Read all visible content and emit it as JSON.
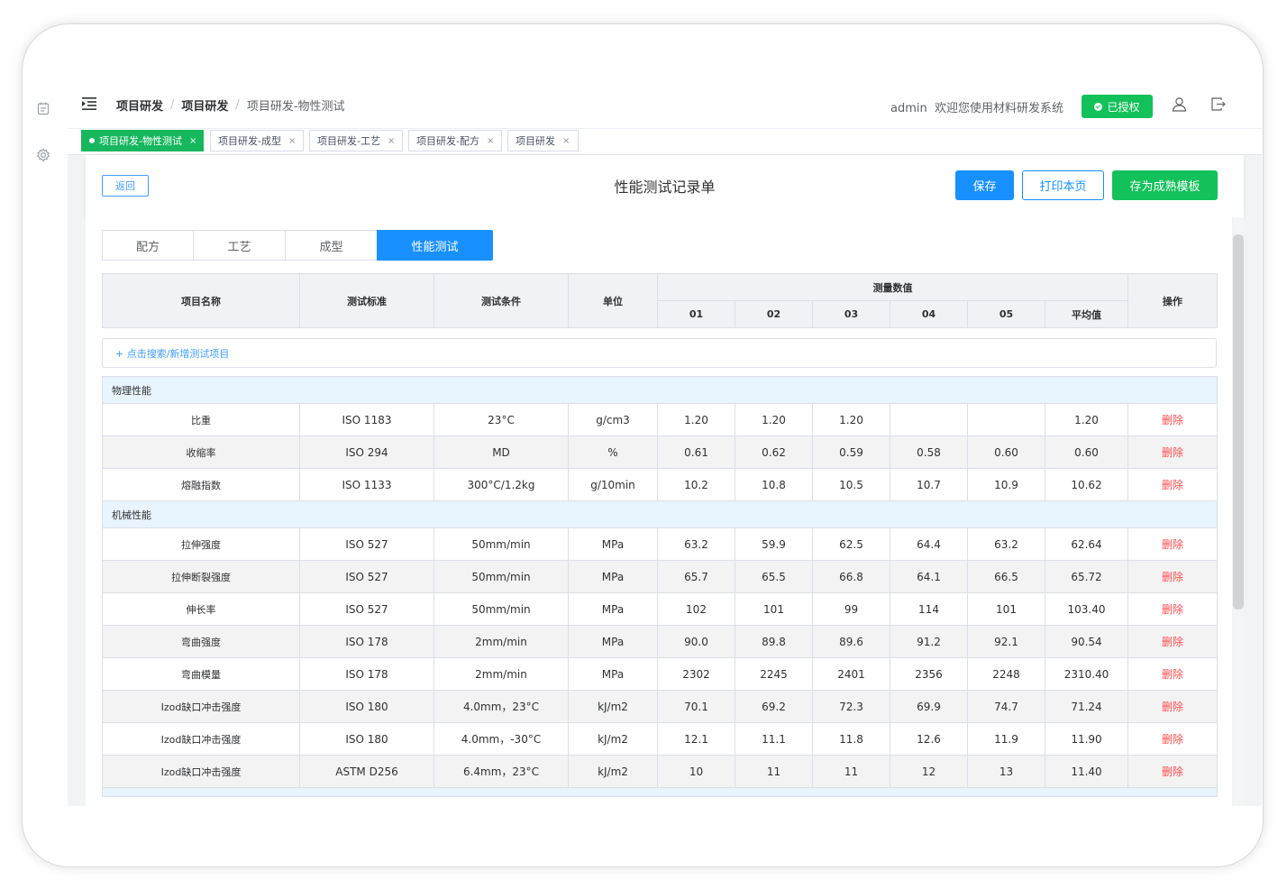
{
  "breadcrumb": [
    "项目研发",
    "项目研发",
    "项目研发-物性测试"
  ],
  "user": {
    "name": "admin",
    "welcome": "欢迎您使用材料研发系统"
  },
  "auth_badge": "已授权",
  "tabs_bar": [
    {
      "label": "项目研发-物性测试",
      "active": true
    },
    {
      "label": "项目研发-成型",
      "active": false
    },
    {
      "label": "项目研发-工艺",
      "active": false
    },
    {
      "label": "项目研发-配方",
      "active": false
    },
    {
      "label": "项目研发",
      "active": false
    }
  ],
  "page": {
    "title": "性能测试记录单",
    "back": "返回",
    "save": "保存",
    "print": "打印本页",
    "save_template": "存为成熟模板"
  },
  "section_tabs": [
    {
      "label": "配方",
      "active": false
    },
    {
      "label": "工艺",
      "active": false
    },
    {
      "label": "成型",
      "active": false
    },
    {
      "label": "性能测试",
      "active": true
    }
  ],
  "table": {
    "headers": {
      "name": "项目名称",
      "standard": "测试标准",
      "condition": "测试条件",
      "unit": "单位",
      "measurements": "测量数值",
      "action": "操作"
    },
    "measure_cols": [
      "01",
      "02",
      "03",
      "04",
      "05",
      "平均值"
    ],
    "add_row": "+ 点击搜索/新增测试项目",
    "delete_label": "删除",
    "groups": [
      {
        "name": "物理性能",
        "rows": [
          {
            "name": "比重",
            "standard": "ISO 1183",
            "condition": "23°C",
            "unit": "g/cm3",
            "values": [
              "1.20",
              "1.20",
              "1.20",
              "",
              ""
            ],
            "avg": "1.20"
          },
          {
            "name": "收缩率",
            "standard": "ISO 294",
            "condition": "MD",
            "unit": "%",
            "values": [
              "0.61",
              "0.62",
              "0.59",
              "0.58",
              "0.60"
            ],
            "avg": "0.60"
          },
          {
            "name": "熔融指数",
            "standard": "ISO 1133",
            "condition": "300°C/1.2kg",
            "unit": "g/10min",
            "values": [
              "10.2",
              "10.8",
              "10.5",
              "10.7",
              "10.9"
            ],
            "avg": "10.62"
          }
        ]
      },
      {
        "name": "机械性能",
        "rows": [
          {
            "name": "拉伸强度",
            "standard": "ISO 527",
            "condition": "50mm/min",
            "unit": "MPa",
            "values": [
              "63.2",
              "59.9",
              "62.5",
              "64.4",
              "63.2"
            ],
            "avg": "62.64"
          },
          {
            "name": "拉伸断裂强度",
            "standard": "ISO 527",
            "condition": "50mm/min",
            "unit": "MPa",
            "values": [
              "65.7",
              "65.5",
              "66.8",
              "64.1",
              "66.5"
            ],
            "avg": "65.72"
          },
          {
            "name": "伸长率",
            "standard": "ISO 527",
            "condition": "50mm/min",
            "unit": "MPa",
            "values": [
              "102",
              "101",
              "99",
              "114",
              "101"
            ],
            "avg": "103.40"
          },
          {
            "name": "弯曲强度",
            "standard": "ISO 178",
            "condition": "2mm/min",
            "unit": "MPa",
            "values": [
              "90.0",
              "89.8",
              "89.6",
              "91.2",
              "92.1"
            ],
            "avg": "90.54"
          },
          {
            "name": "弯曲模量",
            "standard": "ISO 178",
            "condition": "2mm/min",
            "unit": "MPa",
            "values": [
              "2302",
              "2245",
              "2401",
              "2356",
              "2248"
            ],
            "avg": "2310.40"
          },
          {
            "name": "Izod缺口冲击强度",
            "standard": "ISO 180",
            "condition": "4.0mm，23°C",
            "unit": "kJ/m2",
            "values": [
              "70.1",
              "69.2",
              "72.3",
              "69.9",
              "74.7"
            ],
            "avg": "71.24"
          },
          {
            "name": "Izod缺口冲击强度",
            "standard": "ISO 180",
            "condition": "4.0mm，-30°C",
            "unit": "kJ/m2",
            "values": [
              "12.1",
              "11.1",
              "11.8",
              "12.6",
              "11.9"
            ],
            "avg": "11.90"
          },
          {
            "name": "Izod缺口冲击强度",
            "standard": "ASTM D256",
            "condition": "6.4mm，23°C",
            "unit": "kJ/m2",
            "values": [
              "10",
              "11",
              "11",
              "12",
              "13"
            ],
            "avg": "11.40"
          }
        ]
      }
    ]
  },
  "colors": {
    "primary": "#1890ff",
    "success": "#13c15a",
    "danger": "#ff4d4f",
    "category_bg": "#e8f4fe"
  }
}
